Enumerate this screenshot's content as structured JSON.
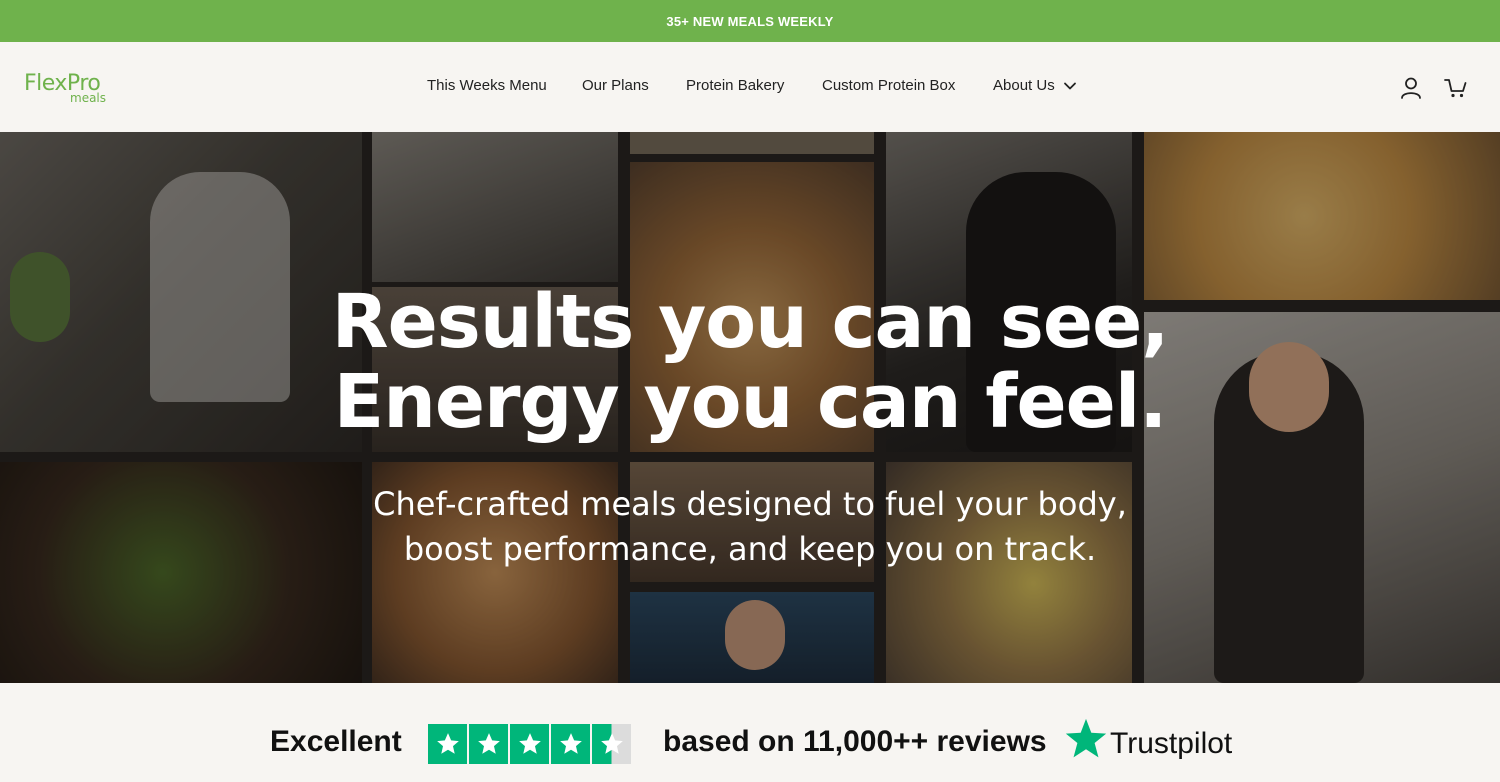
{
  "announcement": {
    "text": "35+ NEW MEALS WEEKLY"
  },
  "brand": {
    "name_main": "FlexPro",
    "name_sub": "meals",
    "color": "#6fb24c"
  },
  "nav": {
    "items": [
      {
        "label": "This Weeks Menu"
      },
      {
        "label": "Our Plans"
      },
      {
        "label": "Protein Bakery"
      },
      {
        "label": "Custom Protein Box"
      },
      {
        "label": "About Us",
        "has_dropdown": true
      }
    ]
  },
  "header_icons": [
    "account-icon",
    "cart-icon"
  ],
  "hero": {
    "title_line1": "Results you can see,",
    "title_line2": "Energy you can feel.",
    "subtitle_line1": "Chef-crafted meals designed to fuel your body,",
    "subtitle_line2": "boost performance, and keep you on track."
  },
  "trust": {
    "rating_word": "Excellent",
    "stars": 4.5,
    "reviews_text": "based on 11,000++ reviews",
    "provider": "Trustpilot",
    "star_color": "#00b67a"
  }
}
